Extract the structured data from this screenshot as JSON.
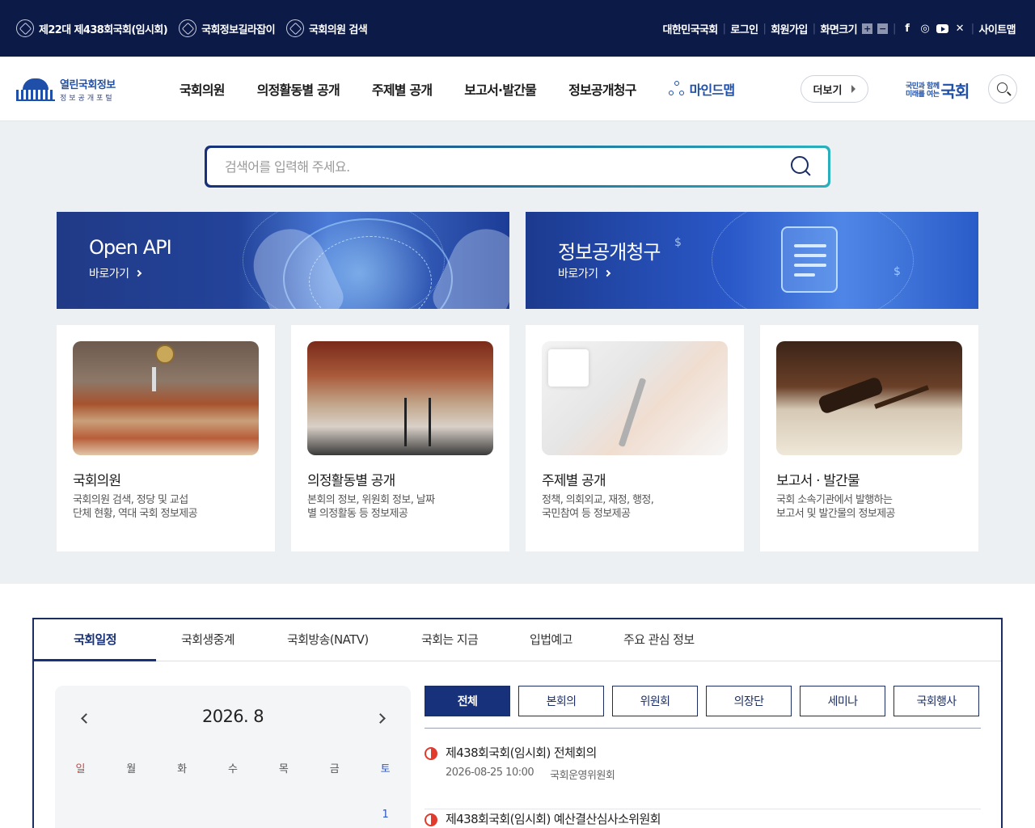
{
  "topbar": {
    "links": [
      {
        "label": "제22대 제438회국회(임시회)",
        "icon": "assembly-emblem-icon"
      },
      {
        "label": "국회정보길라잡이",
        "icon": "assembly-emblem-icon"
      },
      {
        "label": "국회의원 검색",
        "icon": "assembly-emblem-icon"
      }
    ],
    "right": {
      "assembly": "대한민국국회",
      "login": "로그인",
      "signup": "회원가입",
      "font_size": "화면크기",
      "plus": "+",
      "minus": "−",
      "sitemap": "사이트맵",
      "sns": [
        "facebook-icon",
        "instagram-icon",
        "youtube-icon",
        "x-icon"
      ]
    }
  },
  "nav": {
    "logo_title": "열린국회정보",
    "logo_sub": "정보공개포털",
    "menu": [
      "국회의원",
      "의정활동별 공개",
      "주제별 공개",
      "보고서·발간물",
      "정보공개청구"
    ],
    "mindmap": "마인드맵",
    "more": "더보기",
    "national_logo_small_1": "국민과 함께",
    "national_logo_small_2": "미래를 여는",
    "national_logo_big": "국회"
  },
  "search": {
    "placeholder": "검색어를 입력해 주세요."
  },
  "banners": [
    {
      "title": "Open API",
      "link": "바로가기"
    },
    {
      "title": "정보공개청구",
      "link": "바로가기"
    }
  ],
  "cards": [
    {
      "title": "국회의원",
      "desc_1": "국회의원 검색, 정당 및 교섭",
      "desc_2": "단체 현황, 역대 국회 정보제공"
    },
    {
      "title": "의정활동별 공개",
      "desc_1": "본회의 정보, 위원회 정보, 날짜",
      "desc_2": "별 의정활동 등 정보제공"
    },
    {
      "title": "주제별 공개",
      "desc_1": "정책, 의회외교, 재정, 행정,",
      "desc_2": "국민참여 등 정보제공"
    },
    {
      "title": "보고서 · 발간물",
      "desc_1": "국회 소속기관에서 발행하는",
      "desc_2": "보고서 및 발간물의 정보제공"
    }
  ],
  "tabs": [
    "국회일정",
    "국회생중계",
    "국회방송(NATV)",
    "국회는 지금",
    "입법예고",
    "주요 관심 정보"
  ],
  "calendar": {
    "month": "2026. 8",
    "weekdays": [
      "일",
      "월",
      "화",
      "수",
      "목",
      "금",
      "토"
    ],
    "first_row": [
      "",
      "",
      "",
      "",
      "",
      "",
      "1"
    ]
  },
  "filters": [
    "전체",
    "본회의",
    "위원회",
    "의장단",
    "세미나",
    "국회행사"
  ],
  "events": [
    {
      "title": "제438회국회(임시회) 전체회의",
      "datetime": "2026-08-25 10:00",
      "committee": "국회운영위원회"
    },
    {
      "title": "제438회국회(임시회) 예산결산심사소위원회",
      "datetime": "",
      "committee": ""
    }
  ]
}
